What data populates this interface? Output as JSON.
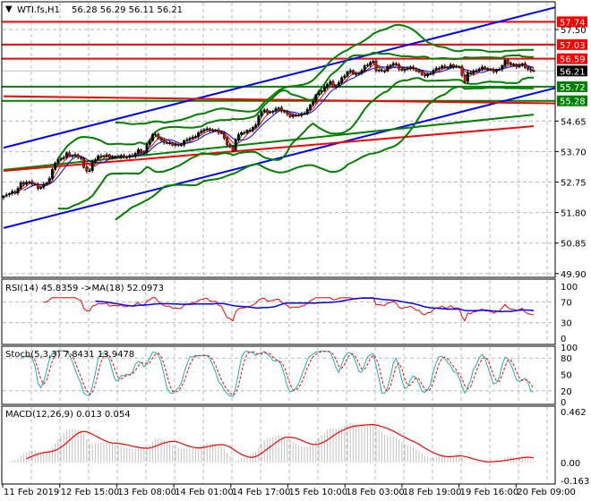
{
  "header": {
    "menu_icon": "triangle-down-icon",
    "symbol": "WTI.fs,H1",
    "ohlc": "56.28 56.29 56.11 56.21"
  },
  "colors": {
    "bull": "#000000",
    "bear": "#ff0000",
    "bands": "#008000",
    "channel": "#0000ff",
    "resistance": "#ff0000",
    "support": "#008000",
    "rsi": "#ff0000",
    "rsi_ma": "#0000ff",
    "stoch_main": "#20b2aa",
    "stoch_signal": "#ff0000",
    "macd_hist": "#c0c0c0",
    "macd_signal": "#ff0000"
  },
  "chart_data": {
    "type": "candlestick",
    "title": "WTI.fs,H1",
    "price_axis": {
      "range": [
        49.9,
        57.5
      ],
      "ticks": [
        "57.50",
        "54.65",
        "53.70",
        "52.75",
        "51.80",
        "50.85",
        "49.90"
      ]
    },
    "time_axis": {
      "ticks": [
        "11 Feb 2019",
        "12 Feb 15:00",
        "13 Feb 08:00",
        "14 Feb 01:00",
        "14 Feb 17:00",
        "15 Feb 10:00",
        "18 Feb 03:00",
        "18 Feb 19:00",
        "19 Feb 16:00",
        "20 Feb 09:00"
      ],
      "tick_bars": [
        0,
        20,
        40,
        60,
        80,
        100,
        120,
        140,
        160,
        180
      ]
    },
    "close_keypoints": [
      [
        0,
        52.29
      ],
      [
        4,
        52.43
      ],
      [
        6,
        52.76
      ],
      [
        9,
        52.71
      ],
      [
        12,
        52.57
      ],
      [
        16,
        52.85
      ],
      [
        18,
        53.32
      ],
      [
        22,
        53.68
      ],
      [
        23,
        53.6
      ],
      [
        27,
        53.46
      ],
      [
        28,
        53.21
      ],
      [
        30,
        53.13
      ],
      [
        31,
        53.4
      ],
      [
        33,
        53.49
      ],
      [
        36,
        53.6
      ],
      [
        39,
        53.54
      ],
      [
        42,
        53.49
      ],
      [
        45,
        53.63
      ],
      [
        47,
        53.74
      ],
      [
        49,
        53.6
      ],
      [
        50,
        53.88
      ],
      [
        52,
        54.24
      ],
      [
        53,
        54.3
      ],
      [
        55,
        54.02
      ],
      [
        57,
        53.91
      ],
      [
        62,
        53.96
      ],
      [
        64,
        54.05
      ],
      [
        66,
        54.1
      ],
      [
        68,
        54.32
      ],
      [
        70,
        54.44
      ],
      [
        72,
        54.32
      ],
      [
        76,
        54.32
      ],
      [
        78,
        53.96
      ],
      [
        80,
        53.68
      ],
      [
        81,
        54.05
      ],
      [
        83,
        54.32
      ],
      [
        85,
        54.38
      ],
      [
        88,
        54.46
      ],
      [
        89,
        54.8
      ],
      [
        91,
        55.02
      ],
      [
        93,
        54.94
      ],
      [
        95,
        55.02
      ],
      [
        99,
        54.88
      ],
      [
        101,
        54.85
      ],
      [
        104,
        54.8
      ],
      [
        105,
        54.88
      ],
      [
        107,
        55.16
      ],
      [
        109,
        55.49
      ],
      [
        112,
        55.63
      ],
      [
        114,
        55.91
      ],
      [
        115,
        55.72
      ],
      [
        118,
        55.97
      ],
      [
        121,
        56.19
      ],
      [
        123,
        56.13
      ],
      [
        126,
        56.33
      ],
      [
        129,
        56.47
      ],
      [
        130,
        56.27
      ],
      [
        133,
        56.25
      ],
      [
        136,
        56.41
      ],
      [
        139,
        56.27
      ],
      [
        141,
        56.33
      ],
      [
        144,
        56.19
      ],
      [
        147,
        56.11
      ],
      [
        150,
        56.19
      ],
      [
        153,
        56.33
      ],
      [
        156,
        56.41
      ],
      [
        159,
        56.27
      ],
      [
        161,
        55.86
      ],
      [
        162,
        56.19
      ],
      [
        166,
        56.25
      ],
      [
        170,
        56.27
      ],
      [
        173,
        56.25
      ],
      [
        175,
        56.47
      ],
      [
        177,
        56.41
      ],
      [
        181,
        56.41
      ],
      [
        183,
        56.19
      ],
      [
        185,
        56.21
      ]
    ],
    "levels": [
      {
        "value": "57.74",
        "price": 57.74,
        "kind": "resistance"
      },
      {
        "value": "57.03",
        "price": 57.03,
        "kind": "resistance"
      },
      {
        "value": "56.59",
        "price": 56.59,
        "kind": "resistance"
      },
      {
        "value": "55.72",
        "price": 55.72,
        "kind": "support"
      },
      {
        "value": "55.28",
        "price": 55.28,
        "kind": "support"
      }
    ],
    "current_price": "56.21",
    "trend_lines": [
      {
        "name": "channel-upper",
        "kind": "channel",
        "from": [
          0,
          53.82
        ],
        "to": [
          193,
          58.2
        ]
      },
      {
        "name": "channel-lower",
        "kind": "channel",
        "from": [
          0,
          51.32
        ],
        "to": [
          193,
          55.69
        ]
      },
      {
        "name": "long-ma-green",
        "kind": "bands",
        "from": [
          0,
          53.13
        ],
        "to": [
          185,
          54.85
        ]
      },
      {
        "name": "long-ma-red",
        "kind": "resistance",
        "from": [
          0,
          53.1
        ],
        "to": [
          185,
          54.49
        ]
      },
      {
        "name": "red-step-level",
        "kind": "resistance",
        "from": [
          0,
          55.42
        ],
        "to": [
          193,
          55.2
        ]
      }
    ],
    "indicators": {
      "rsi": {
        "label": "RSI(14) 45.8359  ->MA(18) 52.0973",
        "ticks": [
          "100",
          "70",
          "30",
          "0"
        ],
        "tick_values": [
          100,
          70,
          30,
          0
        ]
      },
      "stoch": {
        "label": "Stoch(5,3,3) 7.8431 13.9478",
        "ticks": [
          "100",
          "80",
          "50",
          "20",
          "0"
        ],
        "tick_values": [
          100,
          80,
          50,
          20,
          0
        ]
      },
      "macd": {
        "label": "MACD(12,26,9) 0.013 0.054",
        "ticks": [
          "0.462",
          "0.00",
          "-0.163"
        ],
        "tick_values": [
          0.462,
          0,
          -0.163
        ],
        "range": [
          -0.163,
          0.462
        ]
      }
    }
  }
}
